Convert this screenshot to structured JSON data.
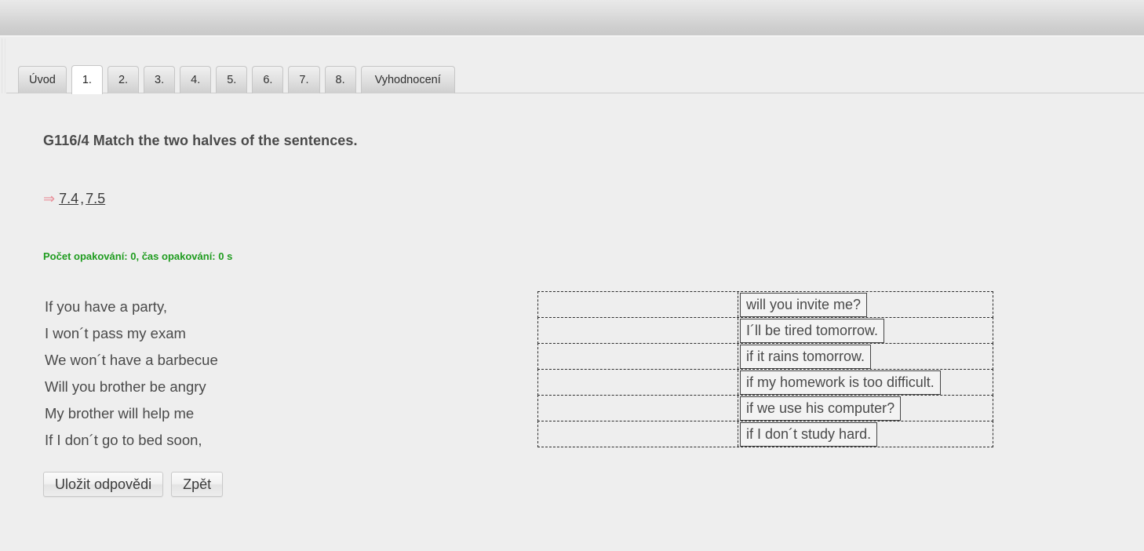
{
  "window": {
    "chrome_bar_label": ""
  },
  "tabs": [
    {
      "label": "Úvod",
      "active": false,
      "kind": "word"
    },
    {
      "label": "1.",
      "active": true,
      "kind": "num"
    },
    {
      "label": "2.",
      "active": false,
      "kind": "num"
    },
    {
      "label": "3.",
      "active": false,
      "kind": "num"
    },
    {
      "label": "4.",
      "active": false,
      "kind": "num"
    },
    {
      "label": "5.",
      "active": false,
      "kind": "num"
    },
    {
      "label": "6.",
      "active": false,
      "kind": "num"
    },
    {
      "label": "7.",
      "active": false,
      "kind": "num"
    },
    {
      "label": "8.",
      "active": false,
      "kind": "num"
    },
    {
      "label": "Vyhodnocení",
      "active": false,
      "kind": "wide"
    }
  ],
  "exercise": {
    "title": "G116/4 Match the two halves of the sentences.",
    "reference": {
      "arrow": "⇒",
      "links": [
        "7.4",
        "7.5"
      ],
      "separator": ","
    },
    "repeat_info": "Počet opakování: 0, čas opakování: 0 s",
    "left_items": [
      "If you have a party,",
      "I won´t pass my exam",
      "We won´t have a barbecue",
      "Will you brother be angry",
      "My brother will help me",
      "If I don´t go to bed soon,"
    ],
    "right_items": [
      "will you invite me?",
      "I´ll be tired tomorrow.",
      "if it rains tomorrow.",
      "if my homework is too difficult.",
      "if we use his computer?",
      "if I don´t study hard."
    ]
  },
  "buttons": {
    "save_label": "Uložit odpovědi",
    "back_label": "Zpět"
  },
  "colors": {
    "page_background": "#eeeeee",
    "heading_text": "#4a4a4a",
    "repeat_info_green": "#1f9c1f",
    "arrow_pink": "#e8909a",
    "dashed_border": "#2c2c2c",
    "chip_border": "#444444",
    "chip_background": "#f3f3f3",
    "active_tab_background": "#ffffff"
  }
}
